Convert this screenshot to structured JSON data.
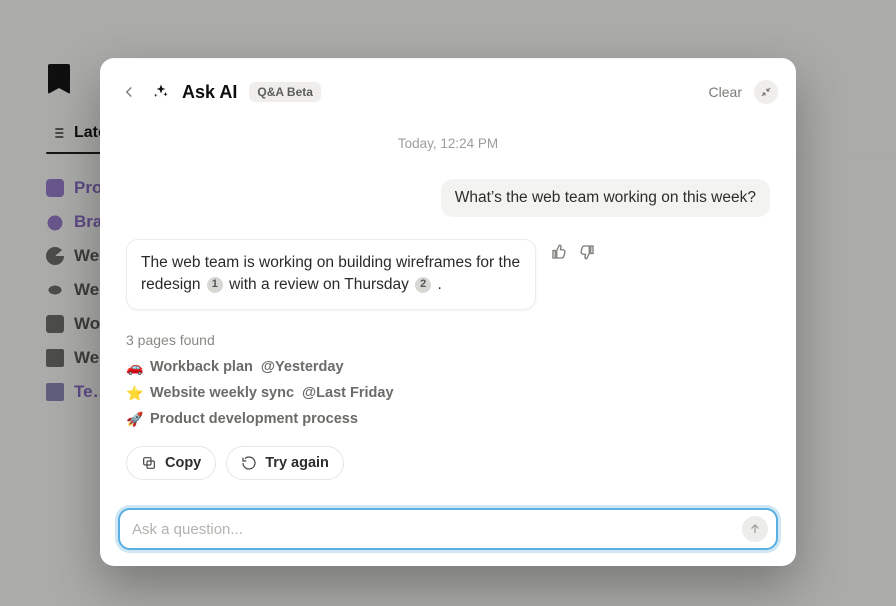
{
  "colors": {
    "accent": "#5AB0E2",
    "accent_ring": "#CFE7F5"
  },
  "background_app": {
    "tab_label": "Latest",
    "list": [
      {
        "text": "Pro…",
        "icon": "radio-icon",
        "color": "purple"
      },
      {
        "text": "Bra…",
        "icon": "palette-icon",
        "color": "purple"
      },
      {
        "text": "We…",
        "icon": "refresh-icon",
        "color": "mono"
      },
      {
        "text": "We…",
        "icon": "rugby-icon",
        "color": "mono"
      },
      {
        "text": "Wo…",
        "icon": "briefcase-icon",
        "color": "mono"
      },
      {
        "text": "We…",
        "icon": "grid-icon",
        "color": "mono"
      },
      {
        "text": "Te…",
        "icon": "page-icon",
        "color": "purple"
      }
    ]
  },
  "modal": {
    "title": "Ask AI",
    "badge": "Q&A Beta",
    "clear_label": "Clear",
    "back_icon": "back-icon",
    "minimize_icon": "minimize-icon",
    "timestamp": "Today, 12:24 PM",
    "user_message": "What’s the web team working on this week?",
    "answer": {
      "prefix": "The web team is working on building wireframes for the redesign ",
      "cite1": "1",
      "middle": " with a review on Thursday ",
      "cite2": "2",
      "suffix": "."
    },
    "found_label": "3 pages found",
    "pages": [
      {
        "emoji": "🚗",
        "title": "Workback plan",
        "when": "@Yesterday"
      },
      {
        "emoji": "⭐",
        "title": "Website weekly sync",
        "when": "@Last Friday"
      },
      {
        "emoji": "🚀",
        "title": "Product development process",
        "when": ""
      }
    ],
    "actions": {
      "copy": "Copy",
      "try_again": "Try again"
    },
    "composer": {
      "placeholder": "Ask a question...",
      "value": ""
    }
  }
}
